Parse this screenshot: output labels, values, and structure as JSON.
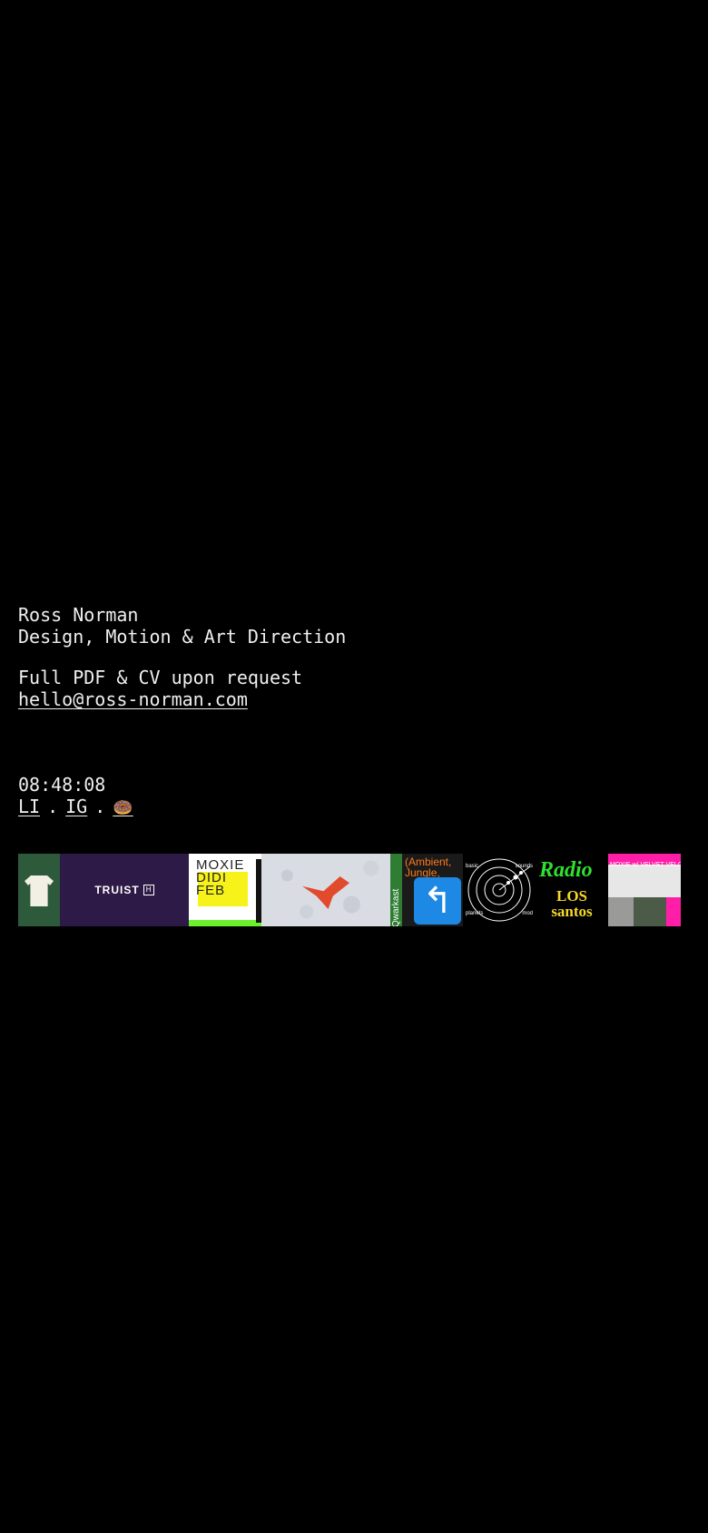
{
  "profile": {
    "name": "Ross Norman",
    "tagline": "Design, Motion & Art Direction",
    "cv_note": "Full PDF & CV upon request",
    "email": "hello@ross-norman.com"
  },
  "meta": {
    "clock": "08:48:08",
    "links": [
      {
        "label": "LI"
      },
      {
        "label": "IG"
      },
      {
        "label": "🍩"
      }
    ],
    "separator": "."
  },
  "gallery": {
    "tiles": [
      {
        "name": "tee-project",
        "icon": "t-shirt-icon"
      },
      {
        "name": "truist-project",
        "text": "TRUIST",
        "mark": "H"
      },
      {
        "name": "moxie-poster-project",
        "text": "MOXIE DIDI FEB"
      },
      {
        "name": "origami-project",
        "icon": "origami-icon"
      },
      {
        "name": "qwarkast-project",
        "side_text": "Qwarkast",
        "headline": "(Ambient, Jungle,",
        "icon": "u-turn-icon"
      },
      {
        "name": "radar-project",
        "labels": [
          "basic",
          "sounds",
          "planets",
          "mod"
        ]
      },
      {
        "name": "radio-los-santos-project",
        "title": "Radio",
        "subtitle": "LOS santos"
      },
      {
        "name": "velvet-velour-project",
        "text": "MOXIE w/ VELVET VELOUR"
      }
    ]
  },
  "colors": {
    "background": "#000000",
    "text": "#efefef"
  }
}
